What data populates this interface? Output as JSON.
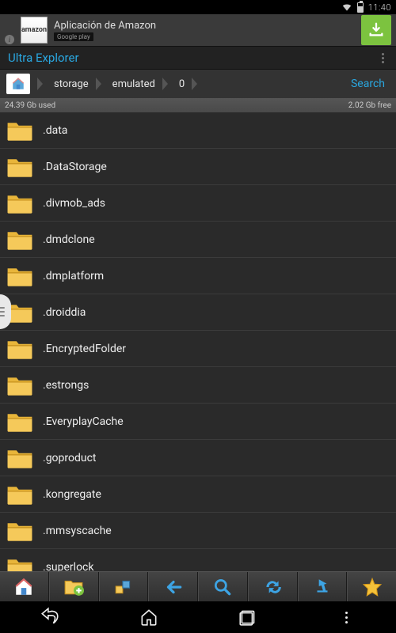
{
  "status": {
    "time": "11:40"
  },
  "ad": {
    "brand": "amazon",
    "text": "Aplicación de Amazon",
    "store": "Google play"
  },
  "app": {
    "title": "Ultra Explorer"
  },
  "breadcrumb": {
    "items": [
      "storage",
      "emulated",
      "0"
    ],
    "search_label": "Search"
  },
  "storage": {
    "used": "24.39 Gb used",
    "free": "2.02 Gb free"
  },
  "folders": [
    ".data",
    ".DataStorage",
    ".divmob_ads",
    ".dmdclone",
    ".dmplatform",
    ".droiddia",
    ".EncryptedFolder",
    ".estrongs",
    ".EveryplayCache",
    ".goproduct",
    ".kongregate",
    ".mmsyscache",
    ".superlock"
  ]
}
